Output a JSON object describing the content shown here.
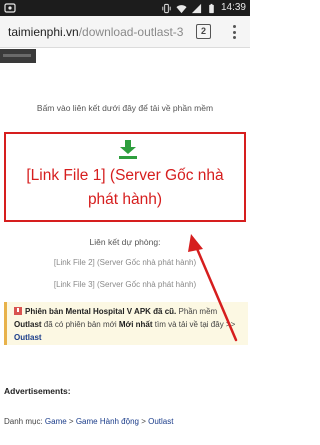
{
  "status_bar": {
    "time": "14:39",
    "icons": [
      "app-notification-icon",
      "vibrate-icon",
      "wifi-icon",
      "signal-icon",
      "battery-icon"
    ]
  },
  "browser": {
    "url_host": "taimienphi.vn",
    "url_path": "/download-outlast-3",
    "tab_count": "2",
    "menu_icon": "overflow-menu-icon"
  },
  "page": {
    "instruction": "Bấm vào liên kết dưới đây để tải về phần mềm",
    "download_icon": "download-arrow-icon",
    "main_link": "[Link File 1] (Server Gốc nhà phát hành)",
    "backup_title": "Liên kết dự phòng:",
    "backup_links": [
      "[Link File 2] (Server Gốc nhà phát hành)",
      "[Link File 3] (Server Gốc nhà phát hành)"
    ],
    "notice": {
      "bold_text": "Phiên bản Mental Hospital V APK đã cũ.",
      "text_1": " Phần mềm ",
      "app_name": "Outlast",
      "text_2": " đã có phiên bản mới",
      "text_3": " Mới nhất",
      "text_4": " tìm và tải về tại đây >> ",
      "link": "Outlast"
    },
    "advertisements_label": "Advertisements:",
    "breadcrumb": {
      "label": "Danh mục: ",
      "items": [
        "Game",
        "Game Hành động",
        "Outlast"
      ],
      "separator": " > "
    }
  },
  "colors": {
    "accent_red": "#d61e1e",
    "download_green": "#2e9e3e",
    "link_blue": "#1a3c8a",
    "notice_bg": "#fcf8e3"
  }
}
